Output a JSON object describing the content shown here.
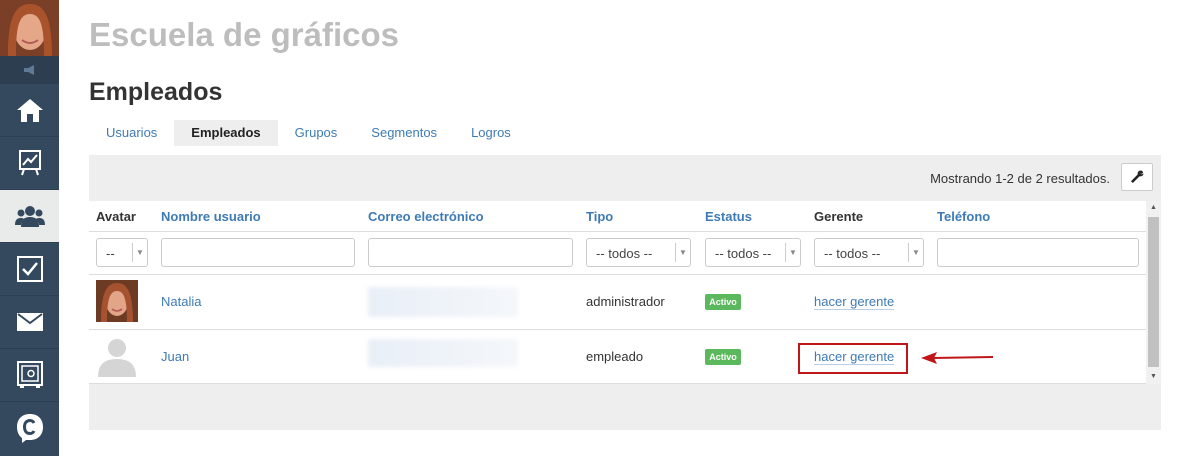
{
  "sidebar": {
    "items": [
      {
        "icon": "home-icon"
      },
      {
        "icon": "chart-icon"
      },
      {
        "icon": "users-icon",
        "active": true
      },
      {
        "icon": "checkbox-icon"
      },
      {
        "icon": "mail-icon"
      },
      {
        "icon": "safe-icon"
      },
      {
        "icon": "c-logo-icon"
      }
    ]
  },
  "header": {
    "school_title": "Escuela de gráficos",
    "page_title": "Empleados"
  },
  "tabs": [
    {
      "label": "Usuarios"
    },
    {
      "label": "Empleados",
      "active": true
    },
    {
      "label": "Grupos"
    },
    {
      "label": "Segmentos"
    },
    {
      "label": "Logros"
    }
  ],
  "toolbar": {
    "results_text": "Mostrando 1-2 de 2 resultados."
  },
  "table": {
    "headers": [
      "Avatar",
      "Nombre usuario",
      "Correo electrónico",
      "Tipo",
      "Estatus",
      "Gerente",
      "Teléfono"
    ],
    "filters": {
      "avatar": "--",
      "tipo": "-- todos --",
      "estatus": "-- todos --",
      "gerente": "-- todos --"
    },
    "rows": [
      {
        "name": "Natalia",
        "tipo": "administrador",
        "estatus": "Activo",
        "gerente": "hacer gerente"
      },
      {
        "name": "Juan",
        "tipo": "empleado",
        "estatus": "Activo",
        "gerente": "hacer gerente"
      }
    ]
  },
  "colors": {
    "sidebar": "#34495e",
    "link": "#3e7bb5",
    "badge": "#5cb85c",
    "highlight": "#c0161a"
  }
}
